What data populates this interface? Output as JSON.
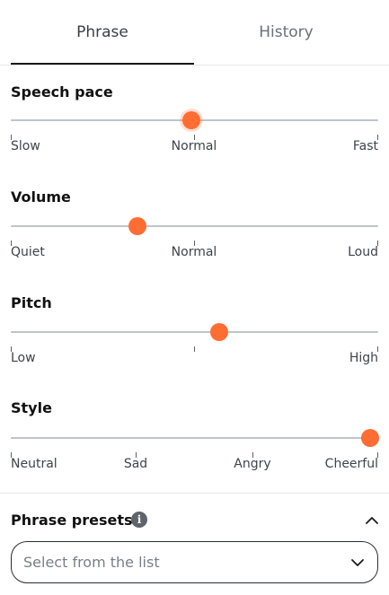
{
  "tabs": [
    {
      "label": "Phrase",
      "active": true
    },
    {
      "label": "History",
      "active": false
    }
  ],
  "sliders": [
    {
      "label": "Speech pace",
      "value": 0.5,
      "ticks": [
        "Slow",
        "Normal",
        "Fast"
      ]
    },
    {
      "label": "Volume",
      "value": 0.35,
      "ticks": [
        "Quiet",
        "Normal",
        "Loud"
      ]
    },
    {
      "label": "Pitch",
      "value": 0.58,
      "ticks": [
        "Low",
        "",
        "High"
      ]
    },
    {
      "label": "Style",
      "value": 1.0,
      "ticks": [
        "Neutral",
        "Sad",
        "Angry",
        "Cheerful"
      ]
    }
  ],
  "presets": {
    "title": "Phrase presets",
    "info_icon": "info-icon",
    "collapse_icon": "chevron-up-icon",
    "select": {
      "placeholder": "Select from the list",
      "icon": "chevron-down-icon"
    }
  },
  "colors": {
    "accent": "#ff6d33",
    "track": "#bfc4ca",
    "text": "#1b1b1b"
  }
}
